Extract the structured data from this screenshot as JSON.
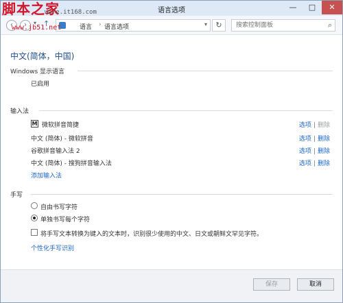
{
  "window": {
    "title": "语言选项",
    "controls": {
      "minimize": "—",
      "maximize": "□",
      "close": "✕"
    }
  },
  "watermark": {
    "brand": "脚本之家",
    "url1": "ware.it168.com",
    "url2": "www.jb51.net"
  },
  "address": {
    "breadcrumb_prev": "语言",
    "separator": "›",
    "breadcrumb_current": "语言选项",
    "search_placeholder": "搜索控制面板"
  },
  "page_title": "中文(简体，中国)",
  "display_language": {
    "header": "Windows 显示语言",
    "status": "已启用"
  },
  "input_methods": {
    "header": "输入法",
    "items": [
      {
        "name": "微软拼音简捷",
        "has_icon": true,
        "option": "选项",
        "delete": "删除",
        "delete_enabled": false
      },
      {
        "name": "中文 (简体) - 微软拼音",
        "option": "选项",
        "delete": "删除",
        "delete_enabled": true
      },
      {
        "name": "谷歌拼音输入法 2",
        "option": "选项",
        "delete": "删除",
        "delete_enabled": true
      },
      {
        "name": "中文 (简体) - 搜狗拼音输入法",
        "option": "选项",
        "delete": "删除",
        "delete_enabled": true
      }
    ],
    "add_link": "添加输入法",
    "separator": "|",
    "icon_letter": "M"
  },
  "handwriting": {
    "header": "手写",
    "radio_freeform": "自由书写字符",
    "radio_single": "单独书写每个字符",
    "checkbox_label": "将手写文本转换为键入的文本时，识别很少使用的中文、日文或朝鲜文罕见字符。",
    "personalize_link": "个性化手写识别"
  },
  "footer": {
    "save": "保存",
    "cancel": "取消"
  },
  "colors": {
    "accent": "#1a66c7",
    "title": "#1e4e8c",
    "close_button": "#c75050",
    "watermark": "#d4162b"
  }
}
